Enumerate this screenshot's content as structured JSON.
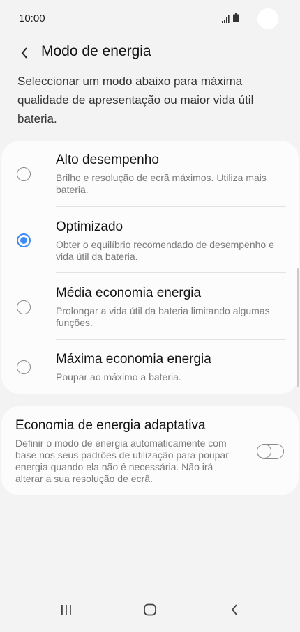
{
  "status_bar": {
    "time": "10:00"
  },
  "header": {
    "title": "Modo de energia"
  },
  "description": "Seleccionar um modo abaixo para máxima qualidade de apresentação ou maior vida útil bateria.",
  "modes": [
    {
      "title": "Alto desempenho",
      "description": "Brilho e resolução de ecrã máximos. Utiliza mais bateria.",
      "selected": false
    },
    {
      "title": "Optimizado",
      "description": "Obter o equilíbrio recomendado de desempenho e vida útil da bateria.",
      "selected": true
    },
    {
      "title": "Média economia energia",
      "description": "Prolongar a vida útil da bateria limitando algumas funções.",
      "selected": false
    },
    {
      "title": "Máxima economia energia",
      "description": "Poupar ao máximo a bateria.",
      "selected": false
    }
  ],
  "adaptive": {
    "title": "Economia de energia adaptativa",
    "description": "Definir o modo de energia automaticamente com base nos seus padrões de utilização para poupar energia quando ela não é necessária. Não irá alterar a sua resolução de ecrã.",
    "enabled": false
  },
  "colors": {
    "accent": "#3e8bf5",
    "background": "#f3f3f3",
    "card": "#fcfcfc"
  },
  "icons": {
    "back": "chevron-left-icon",
    "recents": "recent-apps-icon",
    "home": "home-icon",
    "nav_back": "back-icon"
  }
}
